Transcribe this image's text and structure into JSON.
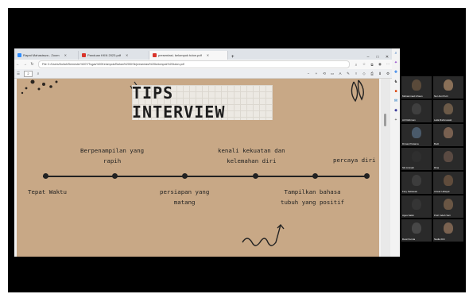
{
  "browser": {
    "tabs": [
      {
        "label": "Rapat Mahasiswa - Zoom",
        "icon": "zoom-icon",
        "color": "#2d8cff"
      },
      {
        "label": "Panduan KKN 2023.pdf",
        "icon": "pdf-icon",
        "color": "#d9342b"
      },
      {
        "label": "presentasi- kelompok tuton.pdf",
        "icon": "pdf-icon",
        "color": "#d9342b"
      }
    ],
    "new_tab": "+",
    "url": "File  C:/Users/Kuliah/Semester%207/Tugas%20Kelompok/Bahan%20KKN/presentasi%20kelompok%20tuton.pdf",
    "page_number": "2",
    "nav_icons": [
      "back-icon",
      "forward-icon",
      "refresh-icon"
    ],
    "pdf_icons": [
      "zoom-out-icon",
      "zoom-in-icon",
      "fit-icon",
      "page-view-icon",
      "read-aloud-icon",
      "draw-icon",
      "highlight-icon",
      "erase-icon",
      "print-icon",
      "save-icon"
    ]
  },
  "slide": {
    "title": "TIPS INTERVIEW",
    "timeline": [
      {
        "label_top": "",
        "label_bottom": "Tepat Waktu"
      },
      {
        "label_top": "Berpenampilan yang\nrapih",
        "label_bottom": ""
      },
      {
        "label_top": "",
        "label_bottom": "persiapan yang\nmatang"
      },
      {
        "label_top": "kenali kekuatan dan\nkelemahan diri",
        "label_bottom": ""
      },
      {
        "label_top": "",
        "label_bottom": "Tampilkan bahasa\ntubuh yang positif"
      },
      {
        "label_top": "percaya diri",
        "label_bottom": ""
      }
    ]
  },
  "participants": [
    {
      "name": "Muhammad Ichsan",
      "color": "#5a4a3a"
    },
    {
      "name": "Nur Aini Putri",
      "color": "#8a7058"
    },
    {
      "name": "Arif Rahman",
      "color": "#3f3f3f"
    },
    {
      "name": "Laila Rahmawati",
      "color": "#6c5a48"
    },
    {
      "name": "Dimas Pratama",
      "color": "#4a5a6a"
    },
    {
      "name": "Budi",
      "color": "#786050"
    },
    {
      "name": "Siti Aminah",
      "color": "#2f2f2f"
    },
    {
      "name": "Rina",
      "color": "#5a4a42"
    },
    {
      "name": "Fery Setiawan",
      "color": "#3d3d3d"
    },
    {
      "name": "Anwar Hidayat",
      "color": "#604c3c"
    },
    {
      "name": "Agus Salim",
      "color": "#353535"
    },
    {
      "name": "Putri Indah Sari",
      "color": "#6a5644"
    },
    {
      "name": "Dewi Kurnia",
      "color": "#474747"
    },
    {
      "name": "Nadia Fitri",
      "color": "#7a6250"
    }
  ]
}
